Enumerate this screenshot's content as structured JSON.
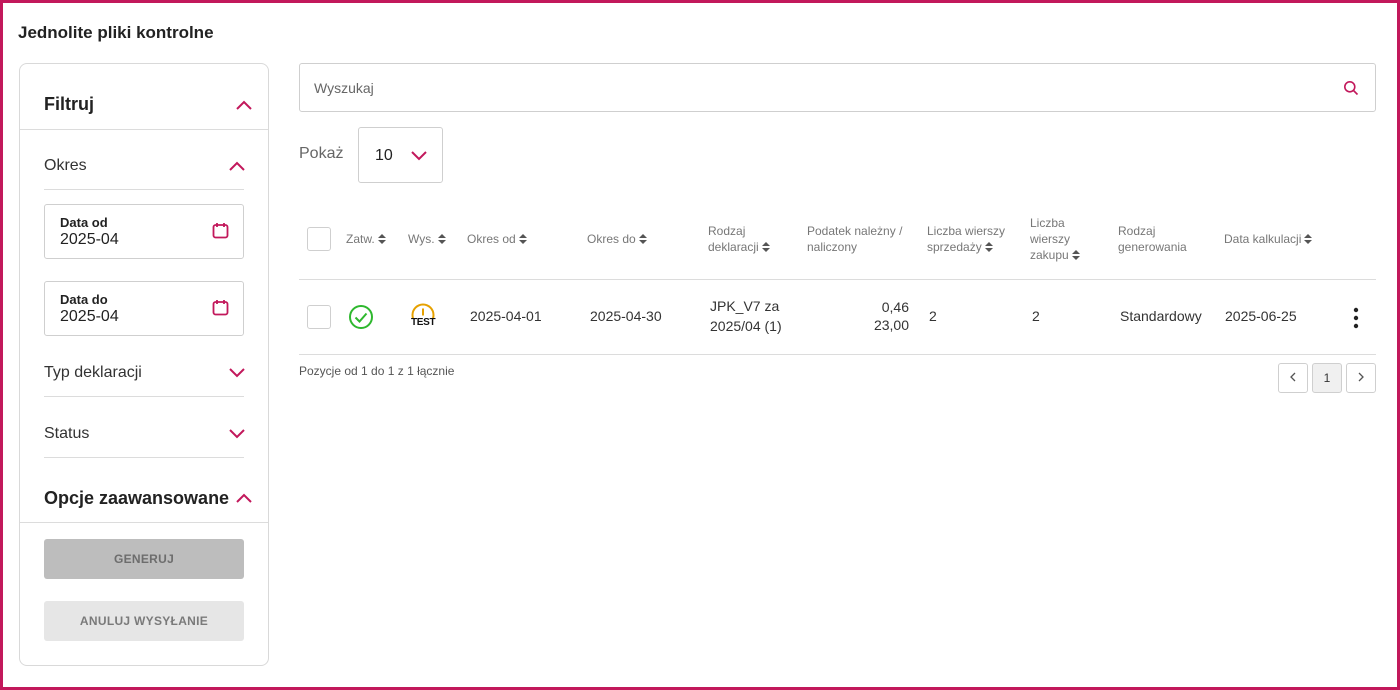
{
  "page": {
    "title": "Jednolite pliki kontrolne"
  },
  "colors": {
    "accent": "#c2185b",
    "ok_green": "#2eb82e",
    "test_amber": "#e6a100"
  },
  "sidebar": {
    "filter_title": "Filtruj",
    "period_label": "Okres",
    "date_from": {
      "caption": "Data od",
      "value": "2025-04"
    },
    "date_to": {
      "caption": "Data do",
      "value": "2025-04"
    },
    "declaration_type_label": "Typ deklaracji",
    "status_label": "Status",
    "advanced_title": "Opcje zaawansowane",
    "generate_label": "GENERUJ",
    "cancel_send_label": "ANULUJ WYSYŁANIE"
  },
  "search": {
    "placeholder": "Wyszukaj",
    "value": ""
  },
  "show": {
    "label": "Pokaż",
    "value": "10"
  },
  "table": {
    "headers": {
      "approved": "Zatw.",
      "sent": "Wys.",
      "period_from": "Okres od",
      "period_to": "Okres do",
      "decl_type_1": "Rodzaj",
      "decl_type_2": "deklaracji",
      "tax_1": "Podatek należny /",
      "tax_2": "naliczony",
      "sales_1": "Liczba wierszy",
      "sales_2": "sprzedaży",
      "purch_1": "Liczba",
      "purch_2": "wierszy",
      "purch_3": "zakupu",
      "gen_1": "Rodzaj",
      "gen_2": "generowania",
      "calc_date": "Data kalkulacji"
    },
    "rows": [
      {
        "status_icon": "check-circle-icon",
        "sent_icon": "test-warning-icon",
        "sent_badge": "TEST",
        "period_from": "2025-04-01",
        "period_to": "2025-04-30",
        "decl_line1": "JPK_V7 za",
        "decl_line2": "2025/04 (1)",
        "tax_due": "0,46",
        "tax_input": "23,00",
        "sales_rows": "2",
        "purchase_rows": "2",
        "generation": "Standardowy",
        "calc_date": "2025-06-25"
      }
    ]
  },
  "pagination": {
    "info": "Pozycje od 1 do 1 z 1 łącznie",
    "current_page": "1"
  }
}
